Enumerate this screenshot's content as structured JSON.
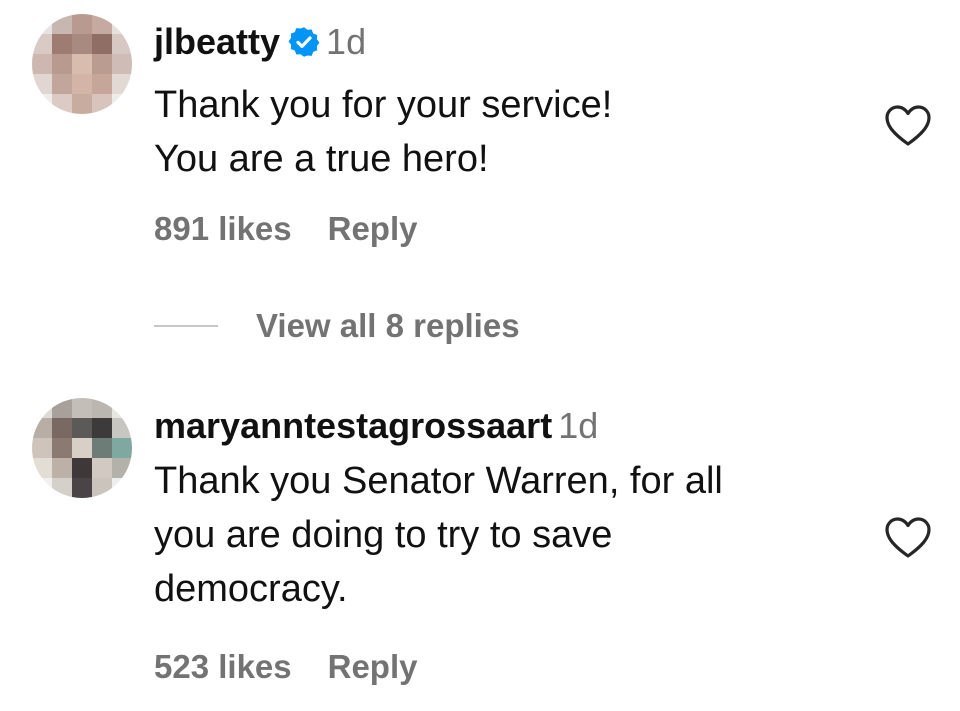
{
  "comments": [
    {
      "username": "jlbeatty",
      "verified": true,
      "time": "1d",
      "text": "Thank you for your service!\nYou are a true hero!",
      "likes": "891 likes",
      "reply_label": "Reply",
      "avatar_colors": [
        "#e8e2e0",
        "#c8b6b0",
        "#b89a90",
        "#c6aaa2",
        "#e6e0de",
        "#d9cac6",
        "#9e7c72",
        "#a88a80",
        "#8f6e66",
        "#d8c8c4",
        "#cdb7b0",
        "#b89a8e",
        "#d8bcae",
        "#bb9c90",
        "#cfbcb6",
        "#e2d6d2",
        "#c2a69c",
        "#d4b4a6",
        "#c6a698",
        "#e2d8d4",
        "#f0ecea",
        "#dccac4",
        "#c8aca0",
        "#d8c4bc",
        "#efebe9"
      ]
    },
    {
      "username": "maryanntestagrossaart",
      "verified": false,
      "time": "1d",
      "text": "Thank you Senator Warren, for all\nyou are doing to try to save\ndemocracy.",
      "likes": "523 likes",
      "reply_label": "Reply",
      "avatar_colors": [
        "#dedad6",
        "#a8a09a",
        "#c4beb8",
        "#bcb6b0",
        "#e8e6e2",
        "#b8aea6",
        "#7a6862",
        "#5c5a58",
        "#3c3a3a",
        "#c8c6c0",
        "#cfc4bc",
        "#8a7a72",
        "#d8d0c6",
        "#6e7c78",
        "#7fa8a0",
        "#e4ddd6",
        "#bdb0a6",
        "#3e3838",
        "#d2cac2",
        "#b4b0aa",
        "#f2f0ee",
        "#d6d0ca",
        "#4a4446",
        "#cac4bc",
        "#eeeeec"
      ]
    }
  ],
  "view_replies": "View all 8 replies",
  "colors": {
    "text": "#111111",
    "secondary": "#737373",
    "verified_blue": "#0095f6",
    "divider": "#c7c7c7"
  },
  "icons": {
    "verified": "verified-badge-icon",
    "like": "heart-icon"
  }
}
